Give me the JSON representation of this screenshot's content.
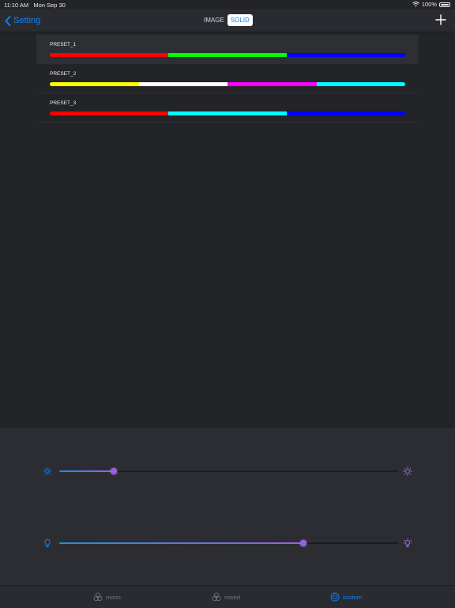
{
  "status_bar": {
    "time": "11:10 AM",
    "date": "Mon Sep 30",
    "battery": "100%"
  },
  "nav": {
    "back_label": "Setting",
    "segments": [
      {
        "label": "IMAGE",
        "selected": false
      },
      {
        "label": "SOLID",
        "selected": true
      }
    ]
  },
  "presets": [
    {
      "name": "PRESET_1",
      "colors": [
        "#ff0000",
        "#00ff00",
        "#0000ff"
      ]
    },
    {
      "name": "PRESET_2",
      "colors": [
        "#ffff00",
        "#ffffff",
        "#ff00ff",
        "#00ffff"
      ]
    },
    {
      "name": "PRESET_3",
      "colors": [
        "#ff0000",
        "#00ffff",
        "#0000ff"
      ]
    }
  ],
  "sliders": {
    "brightness": {
      "value": 0.16,
      "icon_left": "sun-small-icon",
      "icon_right": "sun-large-icon"
    },
    "white": {
      "value": 0.72,
      "icon_left": "bulb-off-icon",
      "icon_right": "bulb-on-icon"
    }
  },
  "tabs": [
    {
      "label": "mono",
      "icon": "circles-icon",
      "active": false
    },
    {
      "label": "mixed",
      "icon": "rgb-circles-icon",
      "active": false
    },
    {
      "label": "custom",
      "icon": "palette-icon",
      "active": true
    }
  ],
  "colors": {
    "accent": "#0a84ff",
    "slider_thumb": "#9a5ee6"
  }
}
